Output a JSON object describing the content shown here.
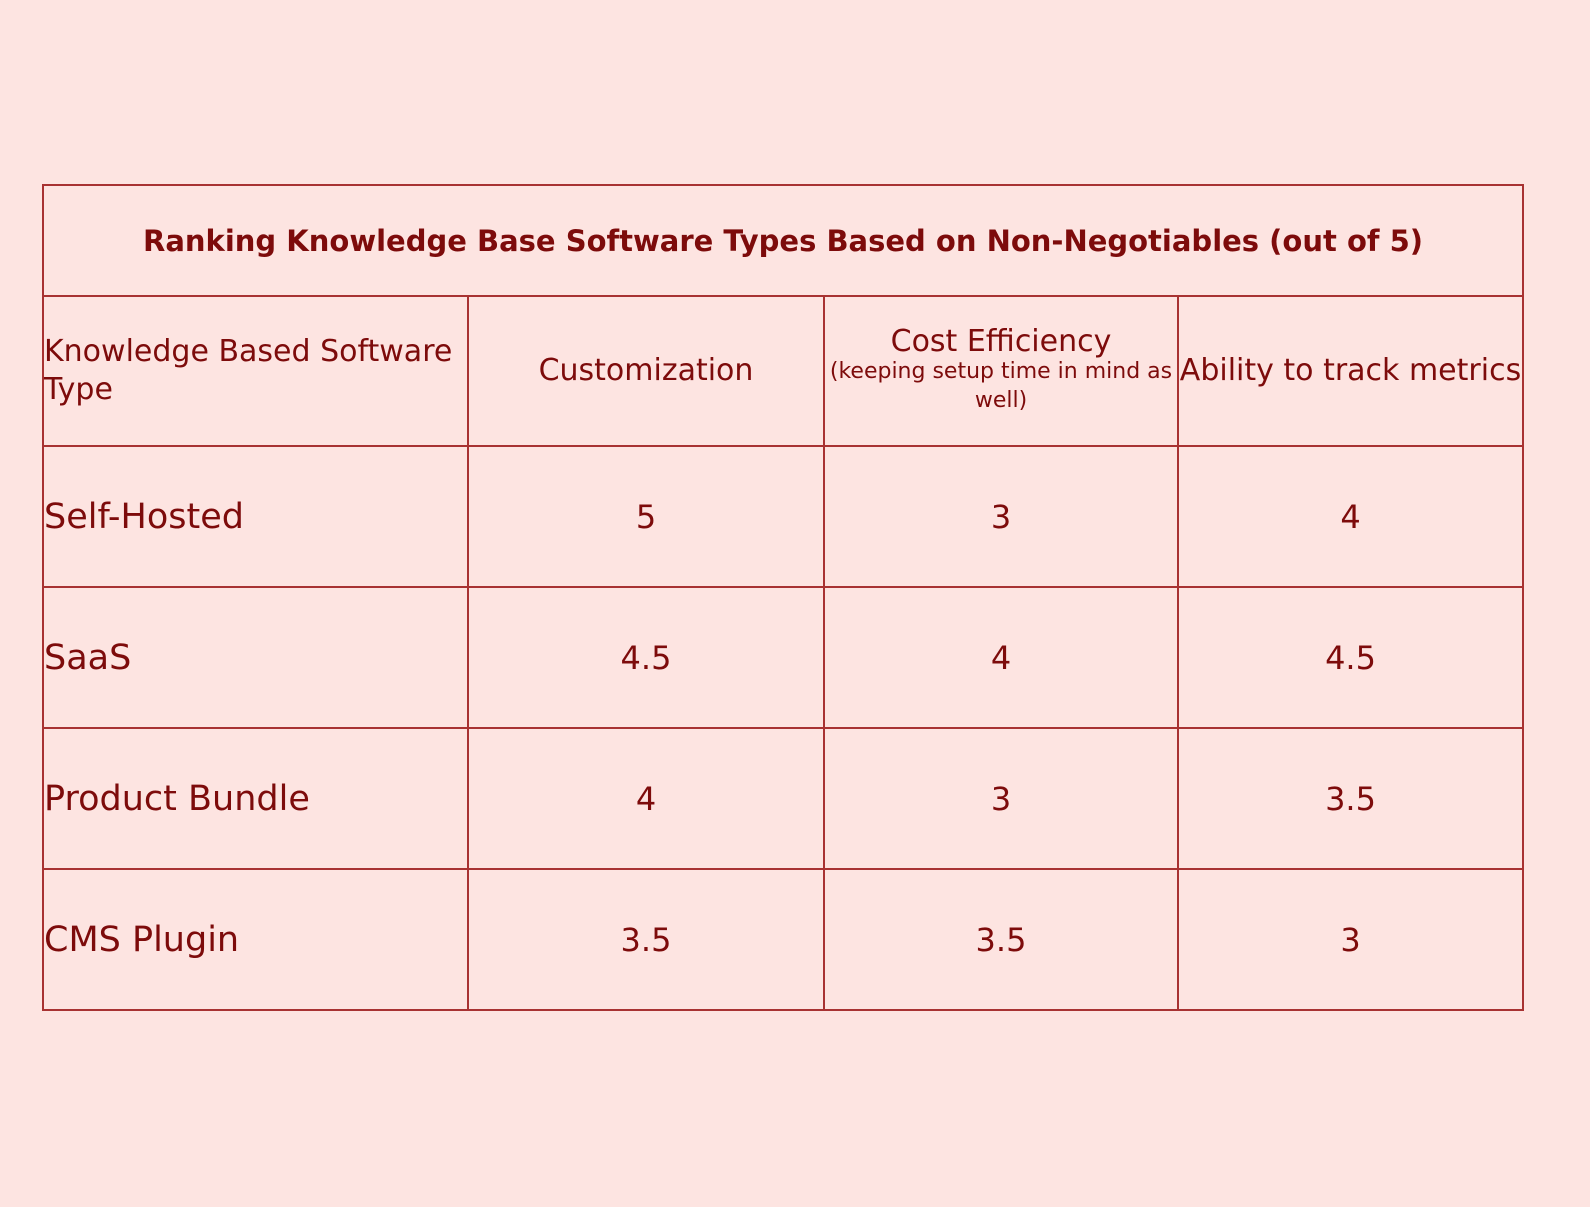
{
  "chart_data": {
    "type": "table",
    "title": "Ranking Knowledge Base Software Types Based on Non-Negotiables (out of 5)",
    "columns": [
      {
        "label": "Knowledge Based Software Type",
        "sublabel": ""
      },
      {
        "label": "Customization",
        "sublabel": ""
      },
      {
        "label": "Cost Efficiency",
        "sublabel": "(keeping setup time in mind as well)"
      },
      {
        "label": "Ability to track metrics",
        "sublabel": ""
      }
    ],
    "rows": [
      {
        "type": "Self-Hosted",
        "values": [
          "5",
          "3",
          "4"
        ]
      },
      {
        "type": "SaaS",
        "values": [
          "4.5",
          "4",
          "4.5"
        ]
      },
      {
        "type": "Product Bundle",
        "values": [
          "4",
          "3",
          "3.5"
        ]
      },
      {
        "type": "CMS Plugin",
        "values": [
          "3.5",
          "3.5",
          "3"
        ]
      }
    ]
  },
  "colors": {
    "background": "#fde4e1",
    "text": "#7d0b0b",
    "border": "#a83232"
  }
}
